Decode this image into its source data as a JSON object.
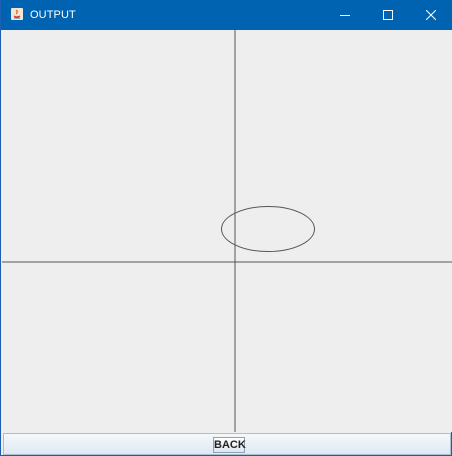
{
  "window": {
    "title": "OUTPUT",
    "icon": "java-app-icon",
    "controls": {
      "minimize_icon": "minimize-icon",
      "maximize_icon": "maximize-icon",
      "close_icon": "close-icon"
    },
    "titlebar_color": "#0063b1"
  },
  "canvas": {
    "background": "#eeeeee",
    "line_color": "#555555",
    "shapes": [
      "x-axis-line",
      "y-axis-line",
      "ellipse"
    ]
  },
  "footer": {
    "back_label": "BACK"
  }
}
